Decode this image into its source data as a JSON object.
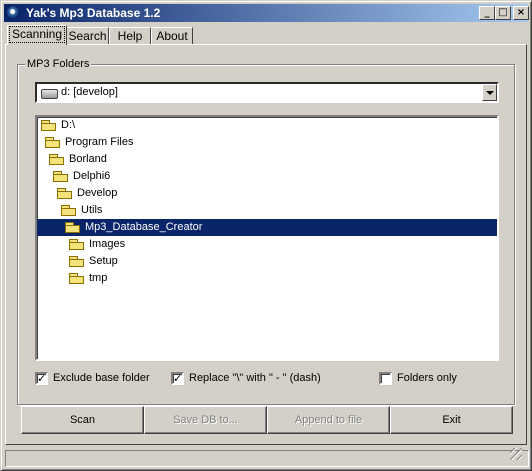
{
  "window": {
    "title": "Yak's Mp3 Database 1.2",
    "controls": [
      "_",
      "□",
      "×"
    ]
  },
  "tabs": [
    {
      "label": "Scanning",
      "active": true
    },
    {
      "label": "Search",
      "active": false
    },
    {
      "label": "Help",
      "active": false
    },
    {
      "label": "About",
      "active": false
    }
  ],
  "group": {
    "caption": "MP3 Folders"
  },
  "drive_combo": {
    "value": "d: [develop]",
    "icon": "drive-icon"
  },
  "tree": {
    "nodes": [
      {
        "label": "D:\\",
        "selected": false,
        "icon": "folder-open-icon"
      },
      {
        "label": "Program Files",
        "selected": false,
        "icon": "folder-open-icon"
      },
      {
        "label": "Borland",
        "selected": false,
        "icon": "folder-open-icon"
      },
      {
        "label": "Delphi6",
        "selected": false,
        "icon": "folder-open-icon"
      },
      {
        "label": "Develop",
        "selected": false,
        "icon": "folder-open-icon"
      },
      {
        "label": "Utils",
        "selected": false,
        "icon": "folder-open-icon"
      },
      {
        "label": "Mp3_Database_Creator",
        "selected": true,
        "icon": "folder-open-icon"
      },
      {
        "label": "Images",
        "selected": false,
        "icon": "folder-icon"
      },
      {
        "label": "Setup",
        "selected": false,
        "icon": "folder-icon"
      },
      {
        "label": "tmp",
        "selected": false,
        "icon": "folder-icon"
      }
    ]
  },
  "options": {
    "exclude_base": {
      "label": "Exclude base folder",
      "checked": true
    },
    "replace_backslash": {
      "label": "Replace \"\\\" with \" - \" (dash)",
      "checked": true
    },
    "folders_only": {
      "label": "Folders only",
      "checked": false
    }
  },
  "buttons": {
    "scan": {
      "label": "Scan",
      "enabled": true
    },
    "save_db": {
      "label": "Save DB to...",
      "enabled": false
    },
    "append": {
      "label": "Append to file",
      "enabled": false
    },
    "exit": {
      "label": "Exit",
      "enabled": true
    }
  },
  "check_mark": "✓"
}
